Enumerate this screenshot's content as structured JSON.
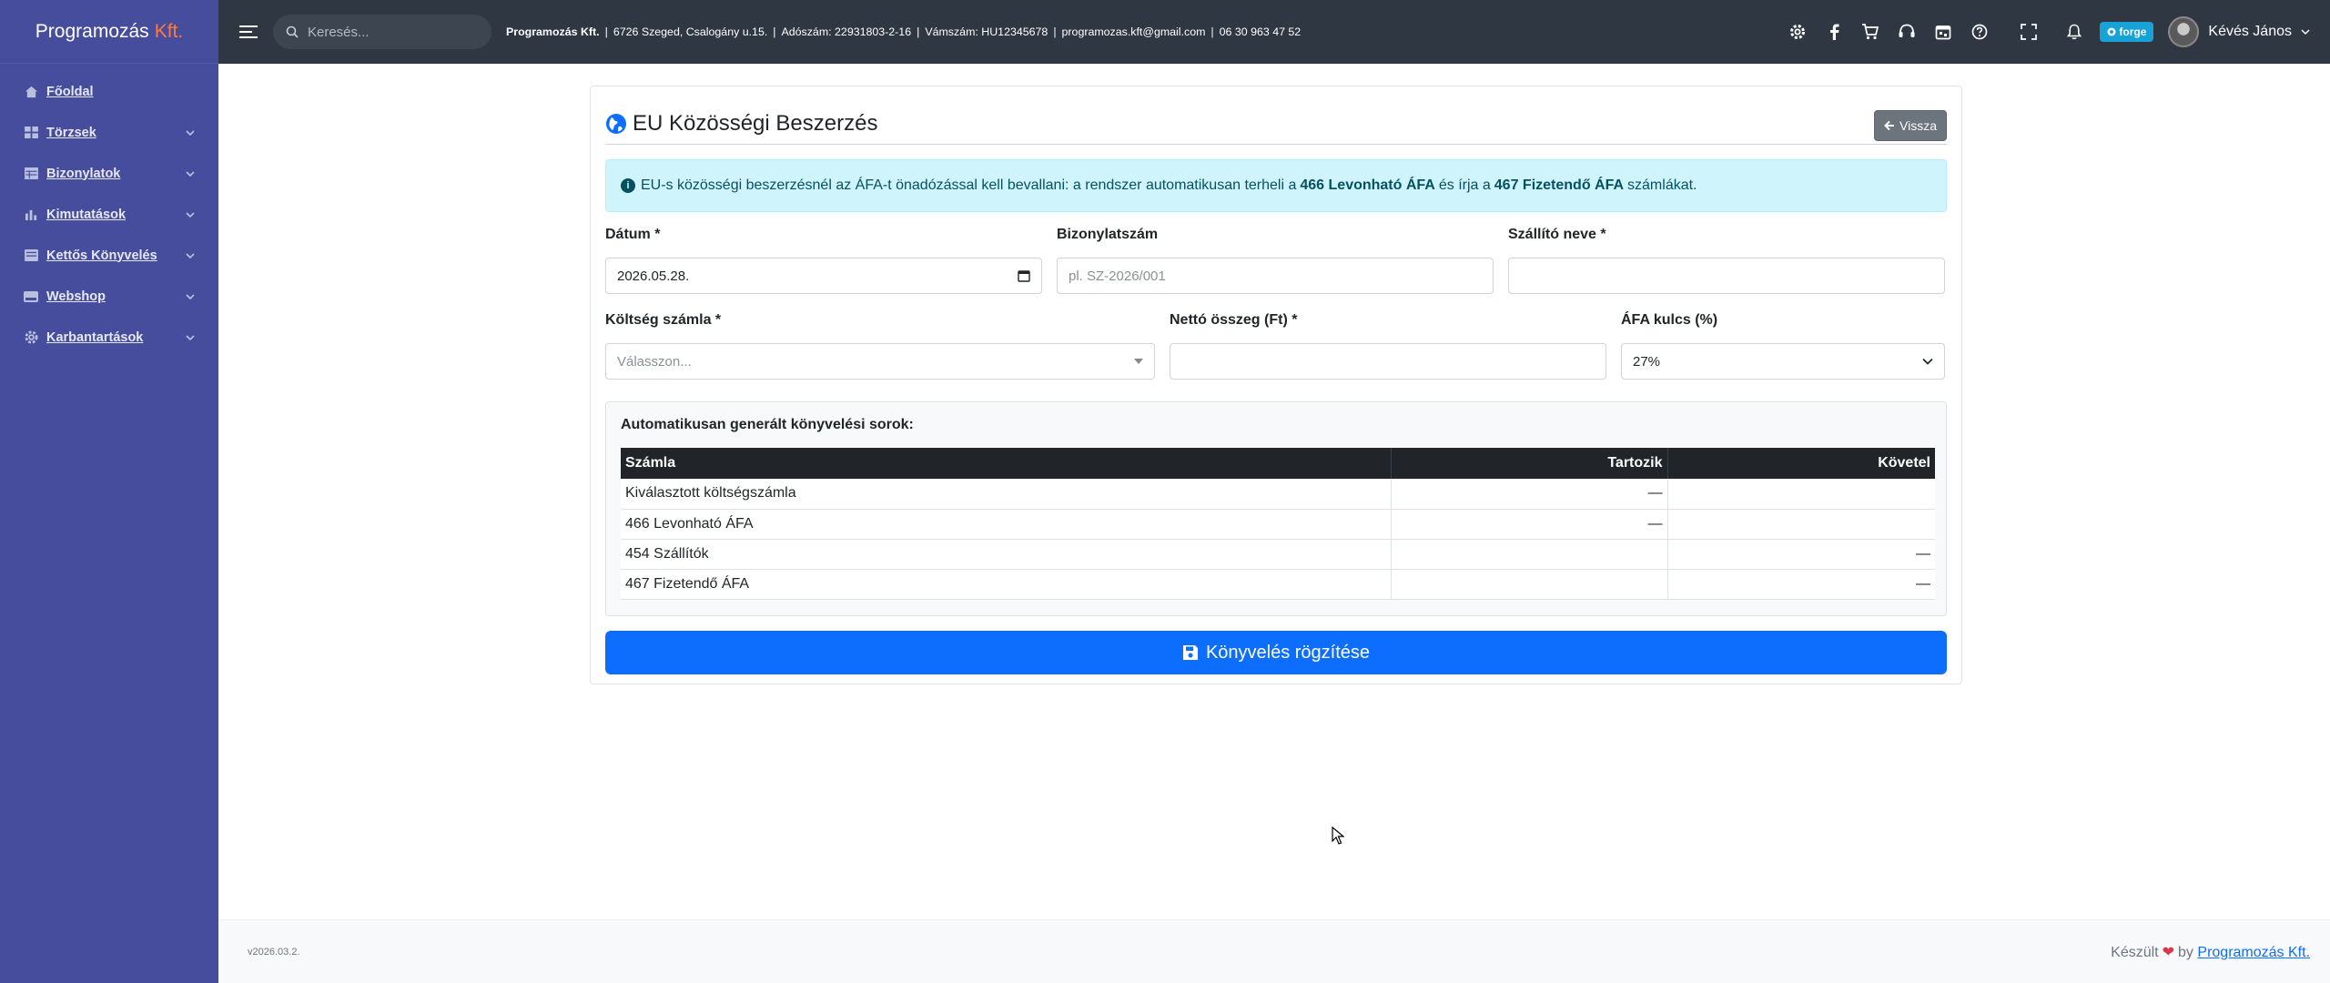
{
  "sidebar": {
    "brand_name": "Programozás",
    "brand_accent": "Kft.",
    "items": [
      {
        "label": "Főoldal",
        "icon": "home-icon",
        "has_children": false
      },
      {
        "label": "Törzsek",
        "icon": "grid-icon",
        "has_children": true
      },
      {
        "label": "Bizonylatok",
        "icon": "table-icon",
        "has_children": true
      },
      {
        "label": "Kimutatások",
        "icon": "bar-chart-icon",
        "has_children": true
      },
      {
        "label": "Kettős Könyvelés",
        "icon": "book-icon",
        "has_children": true
      },
      {
        "label": "Webshop",
        "icon": "drive-icon",
        "has_children": true
      },
      {
        "label": "Karbantartások",
        "icon": "gear-icon",
        "has_children": true
      }
    ]
  },
  "topbar": {
    "search_placeholder": "Keresés...",
    "company_name": "Programozás Kft.",
    "address": "6726 Szeged, Csalogány u.15.",
    "tax_number": "Adószám: 22931803-2-16",
    "vat_number": "Vámszám: HU12345678",
    "email": "programozas.kft@gmail.com",
    "phone": "06 30 963 47 52",
    "forge_label": "forge",
    "user_name": "Kévés János"
  },
  "page": {
    "title": "EU Közösségi Beszerzés",
    "back_label": "Vissza",
    "alert": {
      "prefix": "EU-s közösségi beszerzésnél az ÁFA-t önadózással kell bevallani: a rendszer automatikusan terheli a",
      "account1": "466 Levonható ÁFA",
      "middle": "és írja a",
      "account2": "467 Fizetendő ÁFA",
      "suffix": "számlákat."
    },
    "form": {
      "date_label": "Dátum *",
      "date_value": "2026.05.28.",
      "doc_number_label": "Bizonylatszám",
      "doc_number_placeholder": "pl. SZ-2026/001",
      "supplier_label": "Szállító neve *",
      "supplier_value": "",
      "cost_account_label": "Költség számla *",
      "cost_account_placeholder": "Válasszon...",
      "net_amount_label": "Nettó összeg (Ft) *",
      "net_amount_value": "",
      "vat_rate_label": "ÁFA kulcs (%)",
      "vat_rate_value": "27%"
    },
    "generated": {
      "title": "Automatikusan generált könyvelési sorok:",
      "columns": [
        "Számla",
        "Tartozik",
        "Követel"
      ],
      "rows": [
        {
          "account": "Kiválasztott költségszámla",
          "debit": "—",
          "credit": ""
        },
        {
          "account": "466 Levonható ÁFA",
          "debit": "—",
          "credit": ""
        },
        {
          "account": "454 Szállítók",
          "debit": "",
          "credit": "—"
        },
        {
          "account": "467 Fizetendő ÁFA",
          "debit": "",
          "credit": "—"
        }
      ]
    },
    "submit_label": "Könyvelés rögzítése"
  },
  "footer": {
    "version": "v2026.03.2.",
    "made_prefix": "Készült",
    "made_by": "by",
    "made_link": "Programozás Kft."
  },
  "colors": {
    "sidebar_bg": "#454d9c",
    "topbar_bg": "#2f3742",
    "primary": "#0d6efd",
    "alert_bg": "#cff4fc",
    "brand_accent": "#ff7a3d"
  }
}
